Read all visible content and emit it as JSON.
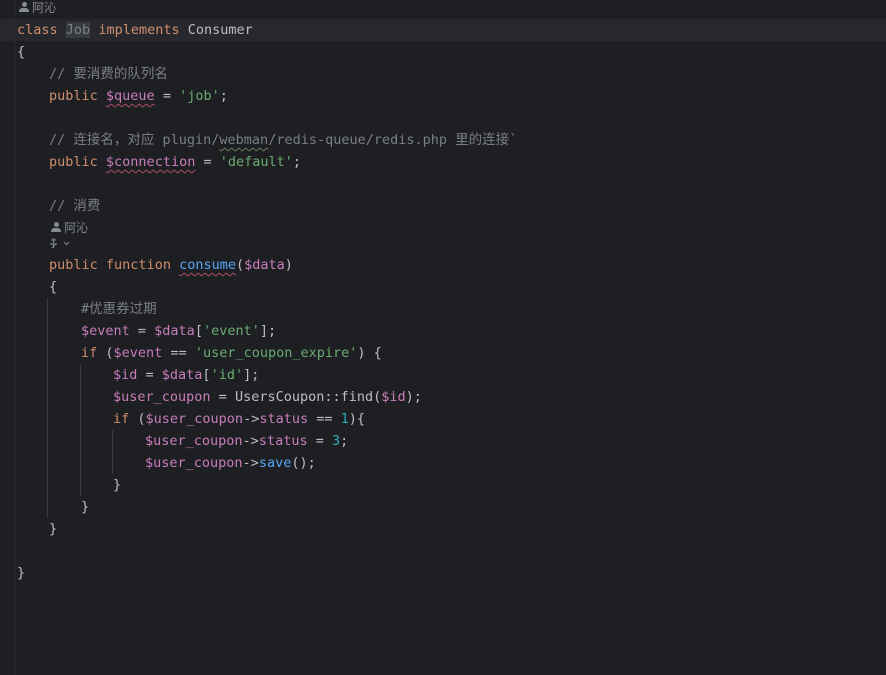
{
  "author_hint": "阿沁",
  "ai_hint_icon": "ai-assistant-icon",
  "class_decl": {
    "kw_class": "class",
    "name": "Job",
    "kw_implements": "implements",
    "iface": "Consumer"
  },
  "open_brace": "{",
  "close_brace": "}",
  "queue_comment": "// 要消费的队列名",
  "queue_line": {
    "kw": "public",
    "var": "$queue",
    "eq": " = ",
    "val": "'job'",
    "semi": ";"
  },
  "conn_comment": {
    "pre": "// 连接名，对应 plugin/",
    "squig": "webman",
    "post": "/redis-queue/redis.php 里的连接`"
  },
  "conn_line": {
    "kw": "public",
    "var": "$connection",
    "eq": " = ",
    "val": "'default'",
    "semi": ";"
  },
  "consume_comment": "// 消费",
  "consume_sig": {
    "kw1": "public",
    "kw2": "function",
    "fn": "consume",
    "open": "(",
    "param": "$data",
    "close": ")"
  },
  "body": {
    "comment": "#优惠券过期",
    "event_assign": {
      "var": "$event",
      "eq": " = ",
      "data": "$data",
      "lb": "[",
      "key": "'event'",
      "rb": "];"
    },
    "if1": {
      "kw": "if",
      "open": " (",
      "var": "$event",
      "op": " == ",
      "val": "'user_coupon_expire'",
      "close": ") {"
    },
    "id_assign": {
      "var": "$id",
      "eq": " = ",
      "data": "$data",
      "lb": "[",
      "key": "'id'",
      "rb": "];"
    },
    "coupon_assign": {
      "var": "$user_coupon",
      "eq": " = ",
      "cls": "UsersCoupon::",
      "fn": "find",
      "open": "(",
      "arg": "$id",
      "close": ");"
    },
    "if2": {
      "kw": "if",
      "open": " (",
      "var": "$user_coupon",
      "arrow": "->",
      "prop": "status",
      "op": " == ",
      "num": "1",
      "close": "){"
    },
    "status_assign": {
      "var": "$user_coupon",
      "arrow": "->",
      "prop": "status",
      "eq": " = ",
      "num": "3",
      "semi": ";"
    },
    "save_call": {
      "var": "$user_coupon",
      "arrow": "->",
      "fn": "save",
      "rest": "();"
    }
  }
}
